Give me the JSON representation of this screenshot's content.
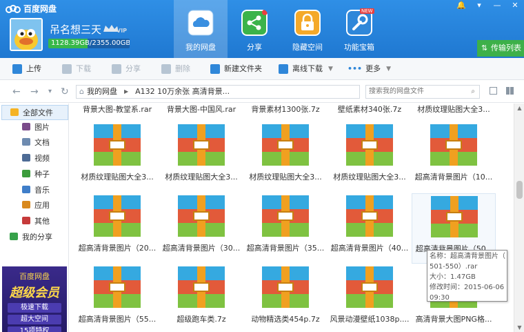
{
  "app": {
    "title": "百度网盘",
    "user": "吊名想三天",
    "vip_badge": "VIP",
    "quota": "1128.39GB/2355.00GB",
    "quota_fraction": 0.479
  },
  "nav": [
    {
      "label": "我的网盘",
      "active": true
    },
    {
      "label": "分享",
      "active": false
    },
    {
      "label": "隐藏空间",
      "active": false
    },
    {
      "label": "功能宝箱",
      "active": false,
      "badge": "NEW"
    }
  ],
  "window": {
    "transfer": "传输列表"
  },
  "toolbar": {
    "upload": "上传",
    "download": "下载",
    "share": "分享",
    "delete": "删除",
    "new_folder": "新建文件夹",
    "offline": "离线下载",
    "more": "更多"
  },
  "address": {
    "root": "我的网盘",
    "current": "A132 10万余张 高清背景...",
    "search_placeholder": "搜索我的网盘文件"
  },
  "sidebar": {
    "items": [
      {
        "label": "全部文件",
        "icon": "folder-icon",
        "color": "#f5b324"
      },
      {
        "label": "图片",
        "icon": "image-icon",
        "color": "#7a4a8a"
      },
      {
        "label": "文档",
        "icon": "document-icon",
        "color": "#6e8bb0"
      },
      {
        "label": "视频",
        "icon": "video-icon",
        "color": "#4d6b95"
      },
      {
        "label": "种子",
        "icon": "bt-icon",
        "color": "#3c9c3c"
      },
      {
        "label": "音乐",
        "icon": "music-icon",
        "color": "#3f7ec9"
      },
      {
        "label": "应用",
        "icon": "app-icon",
        "color": "#d9891d"
      },
      {
        "label": "其他",
        "icon": "other-icon",
        "color": "#c63a3a"
      },
      {
        "label": "我的分享",
        "icon": "share-icon",
        "color": "#37a14a"
      }
    ],
    "promo": {
      "title": "百度网盘",
      "big": "超级会员",
      "perks": [
        "极速下载",
        "超大空间",
        "15项特权"
      ]
    }
  },
  "files": {
    "top_row": [
      "背景大图-教堂系.rar",
      "背景大图-中国风.rar",
      "背景素材1300张.7z",
      "壁纸素材340张.7z",
      "材质纹理贴图大全3..."
    ],
    "rows": [
      [
        "材质纹理贴图大全3...",
        "材质纹理贴图大全3...",
        "材质纹理贴图大全3...",
        "材质纹理贴图大全3...",
        "超高清背景图片（10..."
      ],
      [
        "超高清背景图片（20...",
        "超高清背景图片（30...",
        "超高清背景图片（35...",
        "超高清背景图片（40...",
        "超高清背景图片（50..."
      ],
      [
        "超高清背景图片（55...",
        "超级跑车类.7z",
        "动物精选类454p.7z",
        "风景动漫壁纸1038p....",
        "高清背景大图PNG格..."
      ]
    ]
  },
  "tooltip": {
    "line1": "名称：超高清背景图片（",
    "line2": "501-550）.rar",
    "line3": "大小：1.47GB",
    "line4": "修改时间：2015-06-06",
    "line5": "09:30"
  }
}
